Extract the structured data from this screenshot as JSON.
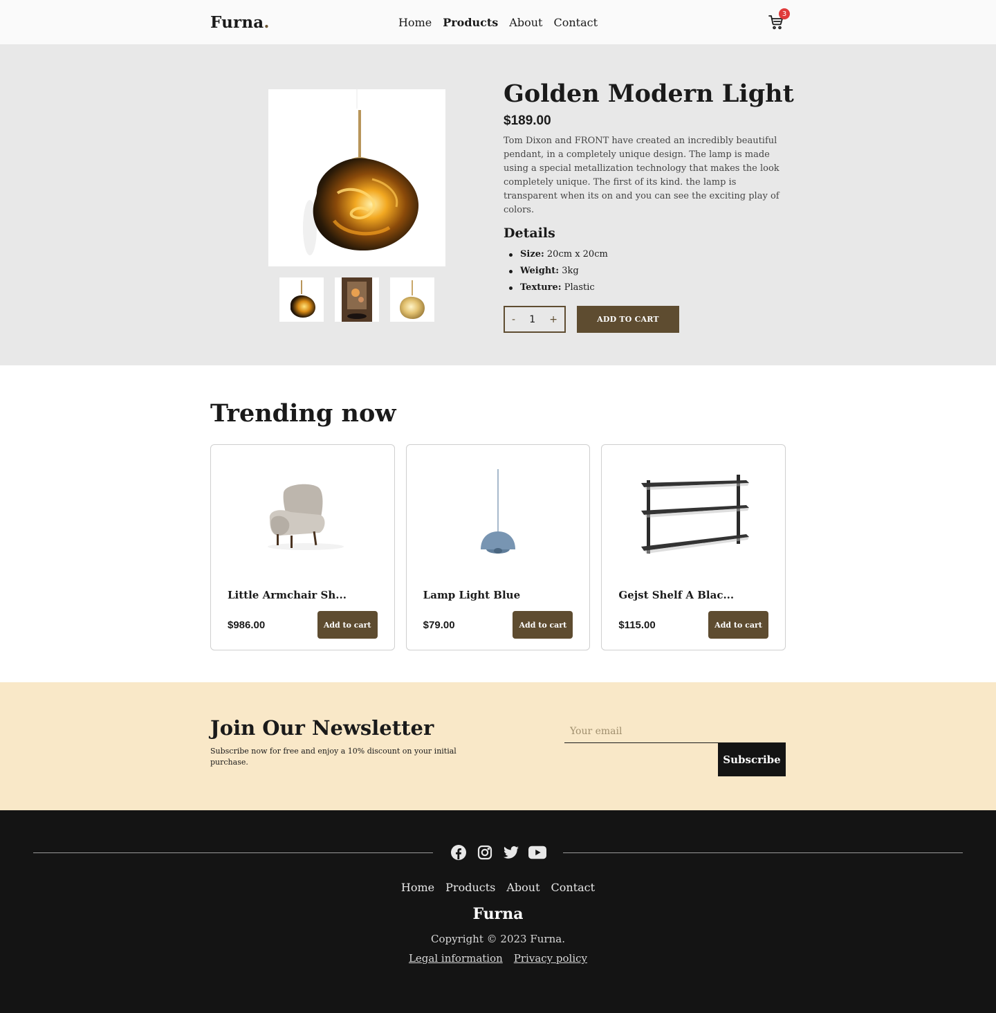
{
  "nav": {
    "logo": "Furna",
    "logo_dot": ".",
    "links": [
      "Home",
      "Products",
      "About",
      "Contact"
    ],
    "active_link": "Products",
    "cart_count": "3",
    "cart_icon": "shopping-cart-icon"
  },
  "product": {
    "title": "Golden Modern Light",
    "price": "$189.00",
    "description": "Tom Dixon and FRONT have created an incredibly beautiful pendant, in a completely unique design. The lamp is made using a special metallization technology that makes the look completely unique. The first of its kind. the lamp is transparent when its on and you can see the exciting play of colors.",
    "details_title": "Details",
    "details": [
      {
        "label": "Size:",
        "value": " 20cm x 20cm"
      },
      {
        "label": "Weight:",
        "value": " 3kg"
      },
      {
        "label": "Texture:",
        "value": " Plastic"
      }
    ],
    "quantity": "1",
    "qty_minus": "-",
    "qty_plus": "+",
    "add_to_cart": "ADD TO CART"
  },
  "trending": {
    "title": "Trending now",
    "items": [
      {
        "name": "Little Armchair Sh...",
        "price": "$986.00",
        "button": "Add to cart"
      },
      {
        "name": "Lamp Light Blue",
        "price": "$79.00",
        "button": "Add to cart"
      },
      {
        "name": "Gejst Shelf A Blac...",
        "price": "$115.00",
        "button": "Add to cart"
      }
    ]
  },
  "newsletter": {
    "title": "Join Our Newsletter",
    "subtitle": "Subscribe now for free and enjoy a 10% discount on your initial purchase.",
    "placeholder": "Your email",
    "button": "Subscribe"
  },
  "footer": {
    "social_icons": [
      "facebook-icon",
      "instagram-icon",
      "twitter-icon",
      "youtube-icon"
    ],
    "links": [
      "Home",
      "Products",
      "About",
      "Contact"
    ],
    "brand": "Furna",
    "copyright": "Copyright © 2023 Furna.",
    "legal": [
      "Legal information",
      "Privacy policy"
    ]
  },
  "colors": {
    "accent": "#5e4c30",
    "hero_bg": "#e8e8e8",
    "newsletter_bg": "#f9e8c8",
    "footer_bg": "#141414",
    "badge": "#e03b3b"
  }
}
